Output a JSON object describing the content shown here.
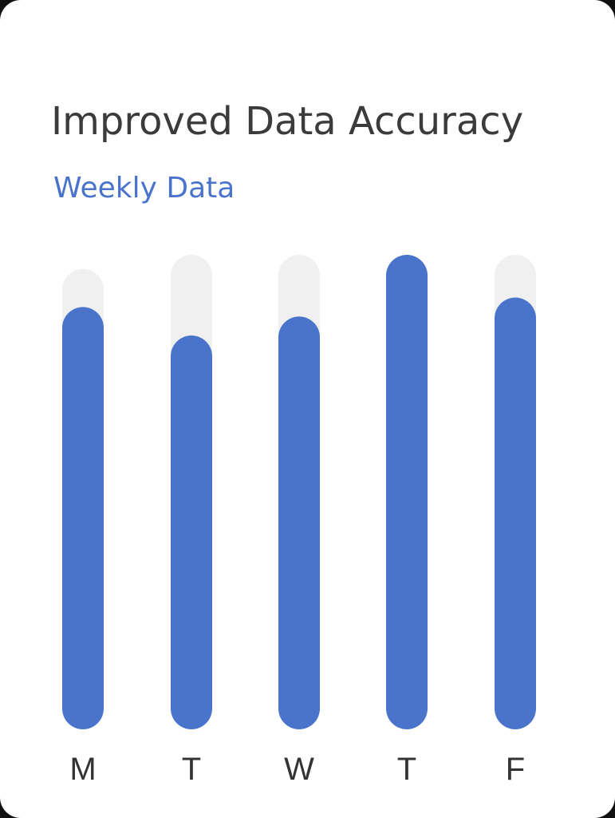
{
  "card": {
    "title": "Improved Data Accuracy",
    "subtitle": "Weekly Data"
  },
  "colors": {
    "bar": "#4a74cc",
    "track": "#f0f0f0",
    "title": "#3b3b3b",
    "subtitle": "#4a74cc"
  },
  "chart_data": {
    "type": "bar",
    "categories": [
      "M",
      "T",
      "W",
      "T",
      "F"
    ],
    "series": [
      {
        "values": [
          89,
          83,
          87,
          100,
          91
        ]
      }
    ],
    "track_values": [
      97,
      100,
      100,
      100,
      100
    ],
    "ylim": [
      0,
      100
    ],
    "grid": false,
    "legend": "none"
  }
}
